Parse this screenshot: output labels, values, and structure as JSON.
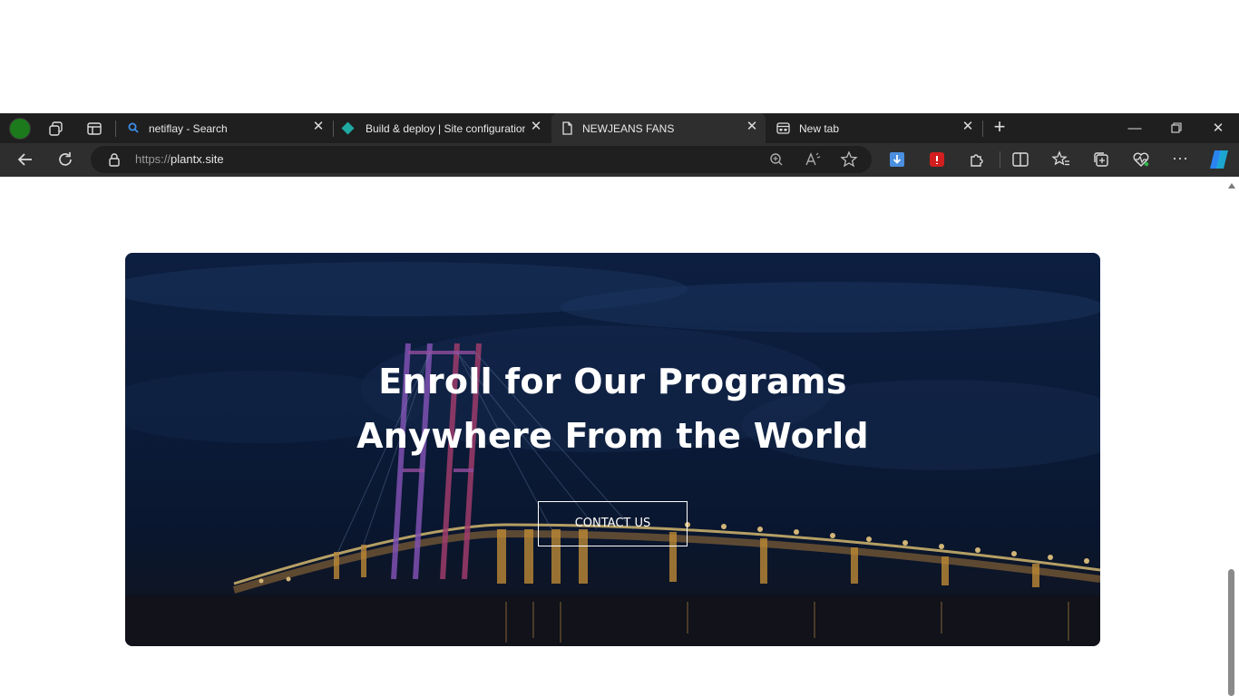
{
  "browser": {
    "tabs": [
      {
        "title": "netiflay - Search",
        "icon": "search-icon"
      },
      {
        "title": "Build & deploy | Site configuration",
        "icon": "netlify-diamond-icon"
      },
      {
        "title": "NEWJEANS FANS",
        "icon": "document-icon",
        "active": true
      },
      {
        "title": "New tab",
        "icon": "new-tab-page-icon"
      }
    ],
    "address": {
      "scheme": "https://",
      "host": "plantx.site"
    },
    "accent_color": "#1c7a1c"
  },
  "page": {
    "hero": {
      "title_line1": "Enroll for Our Programs",
      "title_line2": "Anywhere From the World",
      "cta_label": "CONTACT US"
    }
  }
}
